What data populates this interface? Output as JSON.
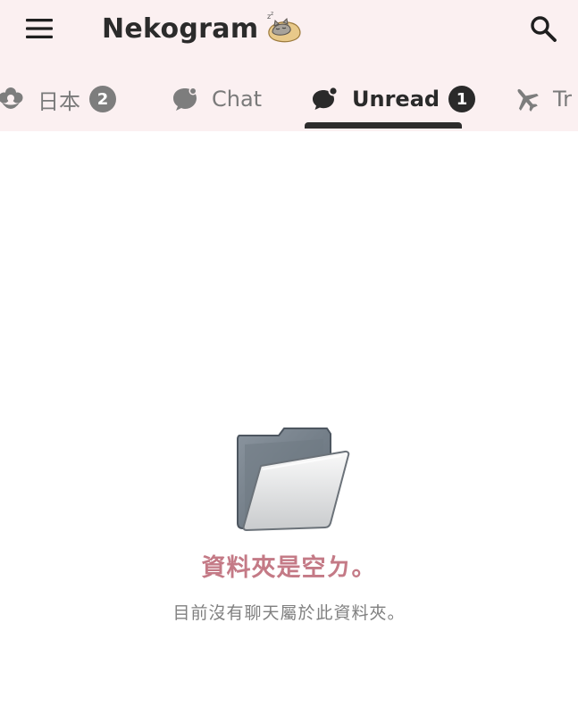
{
  "header": {
    "title": "Nekogram",
    "menu_icon": "hamburger-menu-icon",
    "logo_icon": "sleeping-cat-icon",
    "search_icon": "search-icon",
    "background": "#fbf0f1"
  },
  "tabs": [
    {
      "label": "日本",
      "badge": "2",
      "icon": "flower-icon",
      "active": false
    },
    {
      "label": "Chat",
      "icon": "chat-bubble-icon",
      "active": false
    },
    {
      "label": "Unread",
      "badge": "1",
      "icon": "chat-bubbles-icon",
      "active": true
    },
    {
      "label": "Tr",
      "icon": "airplane-icon",
      "active": false
    }
  ],
  "empty_state": {
    "icon": "empty-folder-icon",
    "title": "資料夾是空ㄉ。",
    "subtitle": "目前沒有聊天屬於此資料夾。",
    "title_color": "#c47a86"
  }
}
